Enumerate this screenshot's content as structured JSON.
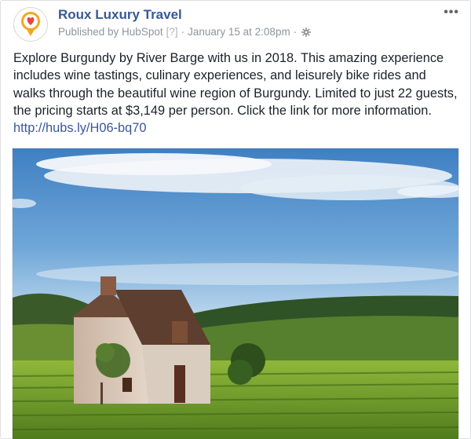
{
  "post": {
    "page_name": "Roux Luxury Travel",
    "published_by": "Published by HubSpot",
    "help_marker": "[?]",
    "separator": "·",
    "timestamp": "January 15 at 2:08pm",
    "more_label": "•••",
    "text": "Explore Burgundy by River Barge with us in 2018. This amazing experience includes wine tastings, culinary experiences, and leisurely bike rides and walks through the beautiful wine region of Burgundy. Limited to just 22 guests, the pricing starts at $3,149 per person. Click the link for more information.",
    "link": "http://hubs.ly/H06-bq70",
    "icons": {
      "avatar": "heart-pin-logo-icon",
      "audience": "gear-icon",
      "more": "more-options-icon"
    },
    "colors": {
      "name": "#365899",
      "link": "#385898",
      "meta": "#90949c",
      "logo_orange": "#f5a623",
      "logo_red": "#e8453c"
    }
  }
}
